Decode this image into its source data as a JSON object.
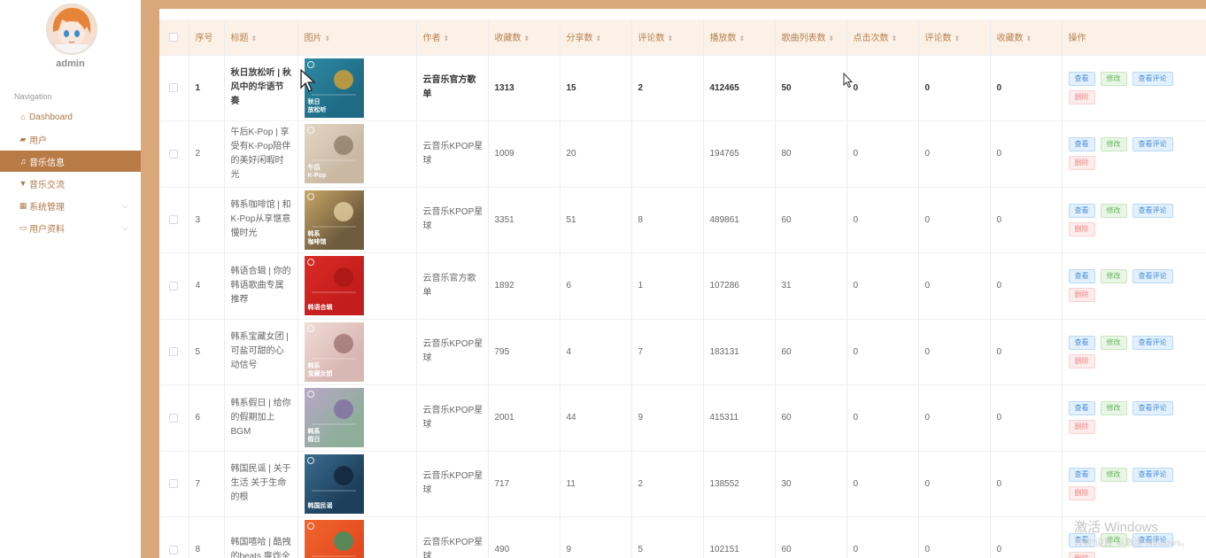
{
  "sidebar": {
    "user": "admin",
    "caption": "Navigation",
    "items": [
      {
        "label": "Dashboard",
        "icon": "home-icon",
        "glyph": "⌂"
      },
      {
        "label": "用户",
        "icon": "ticket-icon",
        "glyph": "▰"
      },
      {
        "label": "音乐信息",
        "icon": "music-icon",
        "glyph": "♫"
      },
      {
        "label": "音乐交流",
        "icon": "chat-icon",
        "glyph": "▼"
      },
      {
        "label": "系统管理",
        "icon": "grid-icon",
        "glyph": "▦"
      },
      {
        "label": "用户资料",
        "icon": "card-icon",
        "glyph": "▭"
      }
    ]
  },
  "table": {
    "headers": [
      "序号",
      "标题",
      "图片",
      "作者",
      "收藏数",
      "分享数",
      "评论数",
      "播放数",
      "歌曲列表数",
      "点击次数",
      "评论数",
      "收藏数",
      "操作"
    ],
    "buttons": {
      "view": "查看",
      "edit": "修改",
      "comments": "查看评论",
      "delete": "删除"
    },
    "rows": [
      {
        "no": "1",
        "title": "秋日放松听 | 秋风中的华语节奏",
        "author": "云音乐官方歌单",
        "fav": "1313",
        "share": "15",
        "comment": "2",
        "play": "412465",
        "songs": "50",
        "clicks": "0",
        "comments2": "0",
        "fav2": "0",
        "thumb_text": "秋日\n放松听",
        "thumb_bg": "#1f6b86",
        "thumb_bg2": "#2d8aa2",
        "thumb_accent": "#e7a42c"
      },
      {
        "no": "2",
        "title": "午后K-Pop | 享受有K-Pop陪伴的美好闲暇时光",
        "author": "云音乐KPOP星球",
        "fav": "1009",
        "share": "20",
        "comment": "",
        "play": "194765",
        "songs": "80",
        "clicks": "0",
        "comments2": "0",
        "fav2": "0",
        "thumb_text": "午后\nK-Pop",
        "thumb_bg": "#c9b9a3",
        "thumb_bg2": "#e3d6c4",
        "thumb_accent": "#8a7a64"
      },
      {
        "no": "3",
        "title": "韩系咖啡馆 | 和K-Pop从享惬意慢时光",
        "author": "云音乐KPOP星球",
        "fav": "3351",
        "share": "51",
        "comment": "8",
        "play": "489861",
        "songs": "60",
        "clicks": "0",
        "comments2": "0",
        "fav2": "0",
        "thumb_text": "韩系\n咖啡馆",
        "thumb_bg": "#6e5a3d",
        "thumb_bg2": "#c8a766",
        "thumb_accent": "#e8d8a8"
      },
      {
        "no": "4",
        "title": "韩语合辑 | 你的韩语歌曲专属推荐",
        "author": "云音乐官方歌单",
        "fav": "1892",
        "share": "6",
        "comment": "1",
        "play": "107286",
        "songs": "31",
        "clicks": "0",
        "comments2": "0",
        "fav2": "0",
        "thumb_text": "韩语合辑",
        "thumb_bg": "#c41d1d",
        "thumb_bg2": "#d92b22",
        "thumb_accent": "#a51515"
      },
      {
        "no": "5",
        "title": "韩系宝藏女团 | 可盐可甜的心动信号",
        "author": "云音乐KPOP星球",
        "fav": "795",
        "share": "4",
        "comment": "7",
        "play": "183131",
        "songs": "60",
        "clicks": "0",
        "comments2": "0",
        "fav2": "0",
        "thumb_text": "韩系\n宝藏女团",
        "thumb_bg": "#d8b7b2",
        "thumb_bg2": "#f1dcd6",
        "thumb_accent": "#9b6e6a"
      },
      {
        "no": "6",
        "title": "韩系假日 | 给你的假期加上BGM",
        "author": "云音乐KPOP星球",
        "fav": "2001",
        "share": "44",
        "comment": "9",
        "play": "415311",
        "songs": "60",
        "clicks": "0",
        "comments2": "0",
        "fav2": "0",
        "thumb_text": "韩系\n假日",
        "thumb_bg": "#8fae9a",
        "thumb_bg2": "#b9a6c9",
        "thumb_accent": "#7f6aa0"
      },
      {
        "no": "7",
        "title": "韩国民谣 | 关于生活 关于生命的根",
        "author": "云音乐KPOP星球",
        "fav": "717",
        "share": "11",
        "comment": "2",
        "play": "138552",
        "songs": "30",
        "clicks": "0",
        "comments2": "0",
        "fav2": "0",
        "thumb_text": "韩国民谣",
        "thumb_bg": "#1d3f5c",
        "thumb_bg2": "#3b6d8f",
        "thumb_accent": "#0f2236"
      },
      {
        "no": "8",
        "title": "韩国嘻哈 | 酷拽的beats 爽炸全",
        "author": "云音乐KPOP星球",
        "fav": "490",
        "share": "9",
        "comment": "5",
        "play": "102151",
        "songs": "60",
        "clicks": "0",
        "comments2": "0",
        "fav2": "0",
        "thumb_text": "",
        "thumb_bg": "#e44a1f",
        "thumb_bg2": "#f0662d",
        "thumb_accent": "#2a9a6a"
      }
    ]
  },
  "watermark": {
    "line1": "激活 Windows",
    "line2": "转到\"设置\"以激活 Windows。"
  }
}
